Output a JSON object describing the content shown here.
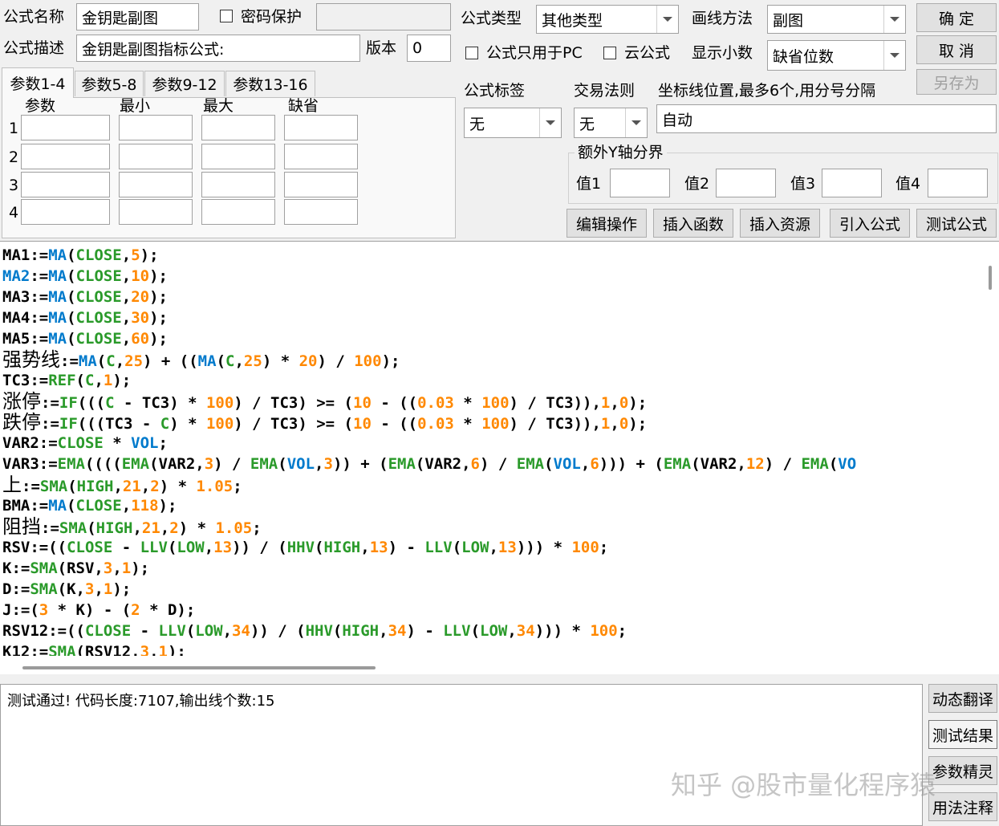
{
  "form": {
    "name_label": "公式名称",
    "name_value": "金钥匙副图",
    "password_label": "密码保护",
    "desc_label": "公式描述",
    "desc_value": "金钥匙副图指标公式:",
    "version_label": "版本",
    "version_value": "0",
    "type_label": "公式类型",
    "type_value": "其他类型",
    "draw_label": "画线方法",
    "draw_value": "副图",
    "pc_only_label": "公式只用于PC",
    "cloud_label": "云公式",
    "decimal_label": "显示小数",
    "decimal_value": "缺省位数",
    "tag_label": "公式标签",
    "tag_value": "无",
    "trade_label": "交易法则",
    "trade_value": "无",
    "axis_label": "坐标线位置,最多6个,用分号分隔",
    "axis_value": "自动",
    "y_bound_label": "额外Y轴分界",
    "y_values": [
      "值1",
      "值2",
      "值3",
      "值4"
    ]
  },
  "buttons": {
    "ok": "确  定",
    "cancel": "取  消",
    "save_as": "另存为",
    "edit": "编辑操作",
    "insert_func": "插入函数",
    "insert_res": "插入资源",
    "import": "引入公式",
    "test": "测试公式",
    "translate": "动态翻译",
    "result": "测试结果",
    "wizard": "参数精灵",
    "usage": "用法注释"
  },
  "params": {
    "tabs": [
      "参数1-4",
      "参数5-8",
      "参数9-12",
      "参数13-16"
    ],
    "headers": [
      "参数",
      "最小",
      "最大",
      "缺省"
    ],
    "rows": [
      "1",
      "2",
      "3",
      "4"
    ]
  },
  "code_lines": [
    [
      [
        "tx",
        "MA1:="
      ],
      [
        "fn",
        "MA"
      ],
      [
        "tx",
        "("
      ],
      [
        "kw",
        "CLOSE"
      ],
      [
        "tx",
        ","
      ],
      [
        "num",
        "5"
      ],
      [
        "tx",
        ");"
      ]
    ],
    [
      [
        "fn",
        "MA2"
      ],
      [
        "tx",
        ":="
      ],
      [
        "fn",
        "MA"
      ],
      [
        "tx",
        "("
      ],
      [
        "kw",
        "CLOSE"
      ],
      [
        "tx",
        ","
      ],
      [
        "num",
        "10"
      ],
      [
        "tx",
        ");"
      ]
    ],
    [
      [
        "tx",
        "MA3:="
      ],
      [
        "fn",
        "MA"
      ],
      [
        "tx",
        "("
      ],
      [
        "kw",
        "CLOSE"
      ],
      [
        "tx",
        ","
      ],
      [
        "num",
        "20"
      ],
      [
        "tx",
        ");"
      ]
    ],
    [
      [
        "tx",
        "MA4:="
      ],
      [
        "fn",
        "MA"
      ],
      [
        "tx",
        "("
      ],
      [
        "kw",
        "CLOSE"
      ],
      [
        "tx",
        ","
      ],
      [
        "num",
        "30"
      ],
      [
        "tx",
        ");"
      ]
    ],
    [
      [
        "tx",
        "MA5:="
      ],
      [
        "fn",
        "MA"
      ],
      [
        "tx",
        "("
      ],
      [
        "kw",
        "CLOSE"
      ],
      [
        "tx",
        ","
      ],
      [
        "num",
        "60"
      ],
      [
        "tx",
        ");"
      ]
    ],
    [
      [
        "cj",
        "强势线"
      ],
      [
        "tx",
        ":="
      ],
      [
        "fn",
        "MA"
      ],
      [
        "tx",
        "("
      ],
      [
        "kw",
        "C"
      ],
      [
        "tx",
        ","
      ],
      [
        "num",
        "25"
      ],
      [
        "tx",
        ") + (("
      ],
      [
        "fn",
        "MA"
      ],
      [
        "tx",
        "("
      ],
      [
        "kw",
        "C"
      ],
      [
        "tx",
        ","
      ],
      [
        "num",
        "25"
      ],
      [
        "tx",
        ") * "
      ],
      [
        "num",
        "20"
      ],
      [
        "tx",
        ") / "
      ],
      [
        "num",
        "100"
      ],
      [
        "tx",
        ");"
      ]
    ],
    [
      [
        "tx",
        "TC3:="
      ],
      [
        "kw",
        "REF"
      ],
      [
        "tx",
        "("
      ],
      [
        "kw",
        "C"
      ],
      [
        "tx",
        ","
      ],
      [
        "num",
        "1"
      ],
      [
        "tx",
        ");"
      ]
    ],
    [
      [
        "cj",
        "涨停"
      ],
      [
        "tx",
        ":="
      ],
      [
        "kw",
        "IF"
      ],
      [
        "tx",
        "((("
      ],
      [
        "kw",
        "C"
      ],
      [
        "tx",
        " - TC3) * "
      ],
      [
        "num",
        "100"
      ],
      [
        "tx",
        ") / TC3) >= ("
      ],
      [
        "num",
        "10"
      ],
      [
        "tx",
        " - (("
      ],
      [
        "num",
        "0.03"
      ],
      [
        "tx",
        " * "
      ],
      [
        "num",
        "100"
      ],
      [
        "tx",
        ") / TC3)),"
      ],
      [
        "num",
        "1"
      ],
      [
        "tx",
        ","
      ],
      [
        "num",
        "0"
      ],
      [
        "tx",
        ");"
      ]
    ],
    [
      [
        "cj",
        "跌停"
      ],
      [
        "tx",
        ":="
      ],
      [
        "kw",
        "IF"
      ],
      [
        "tx",
        "(((TC3 - "
      ],
      [
        "kw",
        "C"
      ],
      [
        "tx",
        ") * "
      ],
      [
        "num",
        "100"
      ],
      [
        "tx",
        ") / TC3) >= ("
      ],
      [
        "num",
        "10"
      ],
      [
        "tx",
        " - (("
      ],
      [
        "num",
        "0.03"
      ],
      [
        "tx",
        " * "
      ],
      [
        "num",
        "100"
      ],
      [
        "tx",
        ") / TC3)),"
      ],
      [
        "num",
        "1"
      ],
      [
        "tx",
        ","
      ],
      [
        "num",
        "0"
      ],
      [
        "tx",
        ");"
      ]
    ],
    [
      [
        "tx",
        "VAR2:="
      ],
      [
        "kw",
        "CLOSE"
      ],
      [
        "tx",
        " * "
      ],
      [
        "fn",
        "VOL"
      ],
      [
        "tx",
        ";"
      ]
    ],
    [
      [
        "tx",
        "VAR3:="
      ],
      [
        "kw",
        "EMA"
      ],
      [
        "tx",
        "(((("
      ],
      [
        "kw",
        "EMA"
      ],
      [
        "tx",
        "(VAR2,"
      ],
      [
        "num",
        "3"
      ],
      [
        "tx",
        ") / "
      ],
      [
        "kw",
        "EMA"
      ],
      [
        "tx",
        "("
      ],
      [
        "fn",
        "VOL"
      ],
      [
        "tx",
        ","
      ],
      [
        "num",
        "3"
      ],
      [
        "tx",
        ")) + ("
      ],
      [
        "kw",
        "EMA"
      ],
      [
        "tx",
        "(VAR2,"
      ],
      [
        "num",
        "6"
      ],
      [
        "tx",
        ") / "
      ],
      [
        "kw",
        "EMA"
      ],
      [
        "tx",
        "("
      ],
      [
        "fn",
        "VOL"
      ],
      [
        "tx",
        ","
      ],
      [
        "num",
        "6"
      ],
      [
        "tx",
        "))) + ("
      ],
      [
        "kw",
        "EMA"
      ],
      [
        "tx",
        "(VAR2,"
      ],
      [
        "num",
        "12"
      ],
      [
        "tx",
        ") / "
      ],
      [
        "kw",
        "EMA"
      ],
      [
        "tx",
        "("
      ],
      [
        "fn",
        "VO"
      ]
    ],
    [
      [
        "cj",
        "上"
      ],
      [
        "tx",
        ":="
      ],
      [
        "kw",
        "SMA"
      ],
      [
        "tx",
        "("
      ],
      [
        "kw",
        "HIGH"
      ],
      [
        "tx",
        ","
      ],
      [
        "num",
        "21"
      ],
      [
        "tx",
        ","
      ],
      [
        "num",
        "2"
      ],
      [
        "tx",
        ") * "
      ],
      [
        "num",
        "1.05"
      ],
      [
        "tx",
        ";"
      ]
    ],
    [
      [
        "tx",
        "BMA:="
      ],
      [
        "fn",
        "MA"
      ],
      [
        "tx",
        "("
      ],
      [
        "kw",
        "CLOSE"
      ],
      [
        "tx",
        ","
      ],
      [
        "num",
        "118"
      ],
      [
        "tx",
        ");"
      ]
    ],
    [
      [
        "cj",
        "阻挡"
      ],
      [
        "tx",
        ":="
      ],
      [
        "kw",
        "SMA"
      ],
      [
        "tx",
        "("
      ],
      [
        "kw",
        "HIGH"
      ],
      [
        "tx",
        ","
      ],
      [
        "num",
        "21"
      ],
      [
        "tx",
        ","
      ],
      [
        "num",
        "2"
      ],
      [
        "tx",
        ") * "
      ],
      [
        "num",
        "1.05"
      ],
      [
        "tx",
        ";"
      ]
    ],
    [
      [
        "tx",
        "RSV:=(("
      ],
      [
        "kw",
        "CLOSE"
      ],
      [
        "tx",
        " - "
      ],
      [
        "kw",
        "LLV"
      ],
      [
        "tx",
        "("
      ],
      [
        "kw",
        "LOW"
      ],
      [
        "tx",
        ","
      ],
      [
        "num",
        "13"
      ],
      [
        "tx",
        ")) / ("
      ],
      [
        "kw",
        "HHV"
      ],
      [
        "tx",
        "("
      ],
      [
        "kw",
        "HIGH"
      ],
      [
        "tx",
        ","
      ],
      [
        "num",
        "13"
      ],
      [
        "tx",
        ") - "
      ],
      [
        "kw",
        "LLV"
      ],
      [
        "tx",
        "("
      ],
      [
        "kw",
        "LOW"
      ],
      [
        "tx",
        ","
      ],
      [
        "num",
        "13"
      ],
      [
        "tx",
        "))) * "
      ],
      [
        "num",
        "100"
      ],
      [
        "tx",
        ";"
      ]
    ],
    [
      [
        "tx",
        "K:="
      ],
      [
        "kw",
        "SMA"
      ],
      [
        "tx",
        "(RSV,"
      ],
      [
        "num",
        "3"
      ],
      [
        "tx",
        ","
      ],
      [
        "num",
        "1"
      ],
      [
        "tx",
        ");"
      ]
    ],
    [
      [
        "tx",
        "D:="
      ],
      [
        "kw",
        "SMA"
      ],
      [
        "tx",
        "(K,"
      ],
      [
        "num",
        "3"
      ],
      [
        "tx",
        ","
      ],
      [
        "num",
        "1"
      ],
      [
        "tx",
        ");"
      ]
    ],
    [
      [
        "tx",
        "J:=("
      ],
      [
        "num",
        "3"
      ],
      [
        "tx",
        " * K) - ("
      ],
      [
        "num",
        "2"
      ],
      [
        "tx",
        " * D);"
      ]
    ],
    [
      [
        "tx",
        "RSV12:=(("
      ],
      [
        "kw",
        "CLOSE"
      ],
      [
        "tx",
        " - "
      ],
      [
        "kw",
        "LLV"
      ],
      [
        "tx",
        "("
      ],
      [
        "kw",
        "LOW"
      ],
      [
        "tx",
        ","
      ],
      [
        "num",
        "34"
      ],
      [
        "tx",
        ")) / ("
      ],
      [
        "kw",
        "HHV"
      ],
      [
        "tx",
        "("
      ],
      [
        "kw",
        "HIGH"
      ],
      [
        "tx",
        ","
      ],
      [
        "num",
        "34"
      ],
      [
        "tx",
        ") - "
      ],
      [
        "kw",
        "LLV"
      ],
      [
        "tx",
        "("
      ],
      [
        "kw",
        "LOW"
      ],
      [
        "tx",
        ","
      ],
      [
        "num",
        "34"
      ],
      [
        "tx",
        "))) * "
      ],
      [
        "num",
        "100"
      ],
      [
        "tx",
        ";"
      ]
    ],
    [
      [
        "tx",
        "K12:="
      ],
      [
        "kw",
        "SMA"
      ],
      [
        "tx",
        "(RSV12,"
      ],
      [
        "num",
        "3"
      ],
      [
        "tx",
        ","
      ],
      [
        "num",
        "1"
      ],
      [
        "tx",
        ");"
      ]
    ]
  ],
  "status": {
    "message": "测试通过! 代码长度:7107,输出线个数:15"
  },
  "watermark": "知乎 @股市量化程序猿",
  "colors": {
    "func": "#007acc",
    "keyword": "#2a9a2a",
    "number": "#ff8800"
  }
}
